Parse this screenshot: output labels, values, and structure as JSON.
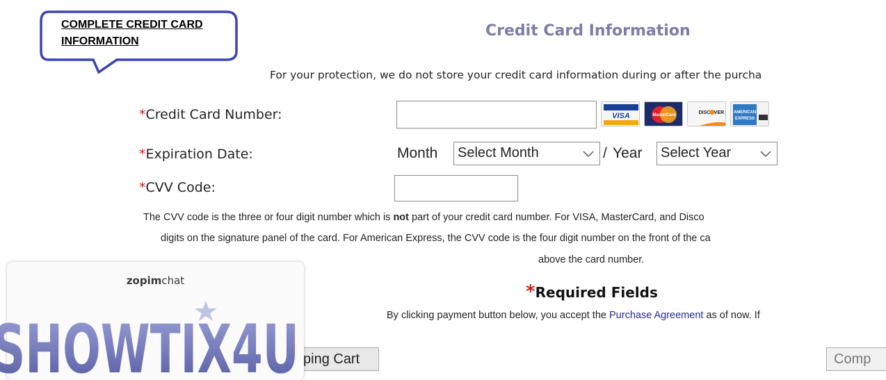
{
  "callout": {
    "text": "COMPLETE CREDIT CARD INFORMATION"
  },
  "section": {
    "title": "Credit Card Information",
    "protection": "For your protection, we do not store your credit card information during or after the purcha"
  },
  "form": {
    "required_mark": "*",
    "card_number_label": "Credit Card Number:",
    "card_number_value": "",
    "expiration_label": "Expiration Date:",
    "month_label": "Month",
    "month_value": "Select Month",
    "separator": "/",
    "year_label": "Year",
    "year_value": "Select Year",
    "cvv_label": "CVV Code:",
    "cvv_value": ""
  },
  "cards": [
    {
      "name": "VISA",
      "icon": "visa-card-icon"
    },
    {
      "name": "MasterCard",
      "icon": "mastercard-icon"
    },
    {
      "name": "DISCOVER",
      "icon": "discover-card-icon"
    },
    {
      "name": "American Express",
      "icon": "amex-card-icon"
    }
  ],
  "cvv_help": {
    "line1_before": "The CVV code is the three or four digit number which is ",
    "line1_bold": "not",
    "line1_after": " part of your credit card number. For VISA, MasterCard, and Disco",
    "line2": "digits on the signature panel of the card. For American Express, the CVV code is the four digit number on the front of the ca",
    "line3": "above the card number."
  },
  "required": {
    "mark": "*",
    "text": "Required Fields"
  },
  "agreement": {
    "before": "By clicking payment button below, you accept the ",
    "link": "Purchase Agreement",
    "after": " as of now. If"
  },
  "buttons": {
    "cart_partial": "ping Cart",
    "complete_partial": "Comp"
  },
  "chat": {
    "brand_bold": "zopim",
    "brand_rest": "chat",
    "logo_text": "SHOWTIX4U"
  },
  "colors": {
    "callout_border": "#3c44b4",
    "title": "#7d7ea8",
    "required": "#cc2222",
    "link": "#262a92",
    "logo": "#6e72b4"
  }
}
